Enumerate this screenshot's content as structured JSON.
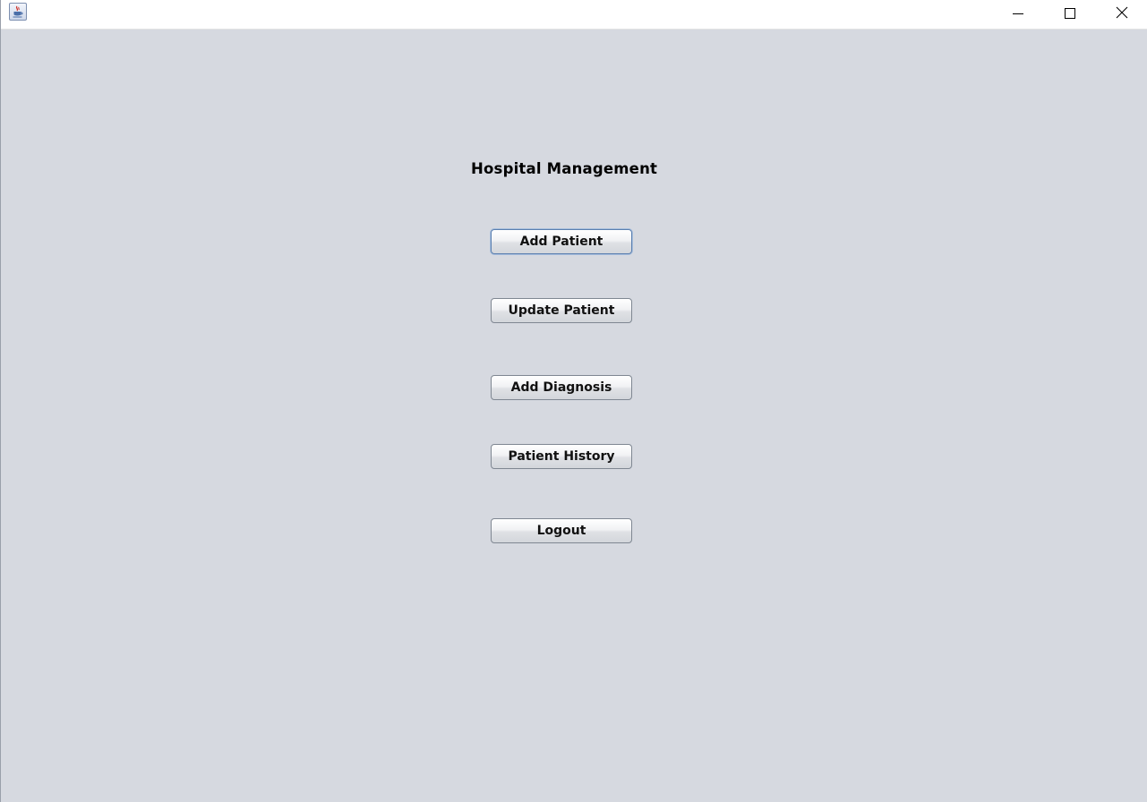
{
  "window": {
    "icon": "java-cup-icon",
    "controls": {
      "minimize_icon": "minimize-icon",
      "maximize_icon": "maximize-icon",
      "close_icon": "close-icon"
    }
  },
  "main": {
    "title": "Hospital Management",
    "buttons": {
      "add_patient": "Add Patient",
      "update_patient": "Update Patient",
      "add_diagnosis": "Add Diagnosis",
      "patient_history": "Patient History",
      "logout": "Logout"
    },
    "focused_button": "Add Patient"
  },
  "colors": {
    "background": "#d6d9e0",
    "titlebar": "#ffffff",
    "focus_ring": "#5a7fb0"
  }
}
